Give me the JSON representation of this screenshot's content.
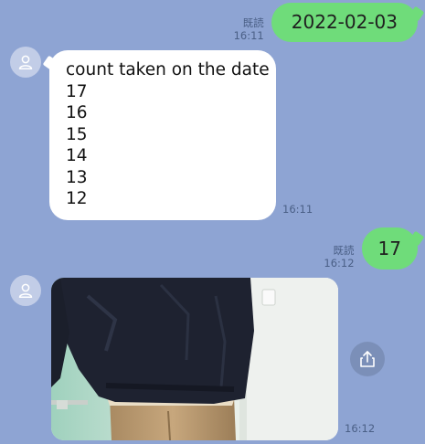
{
  "messages": {
    "date_msg": {
      "read_label": "既読",
      "time": "16:11",
      "text": "2022-02-03"
    },
    "count_msg": {
      "lines": [
        "count taken on the date",
        "17",
        "16",
        "15",
        "14",
        "13",
        "12"
      ],
      "time": "16:11"
    },
    "reply_msg": {
      "read_label": "既読",
      "time": "16:12",
      "text": "17"
    },
    "photo_msg": {
      "time": "16:12"
    }
  },
  "icons": {
    "avatar": "person-icon",
    "share": "share-icon"
  },
  "colors": {
    "background": "#8ea4d3",
    "outgoing_bubble": "#6fdc7a",
    "incoming_bubble": "#ffffff",
    "avatar": "#c2cde7"
  }
}
